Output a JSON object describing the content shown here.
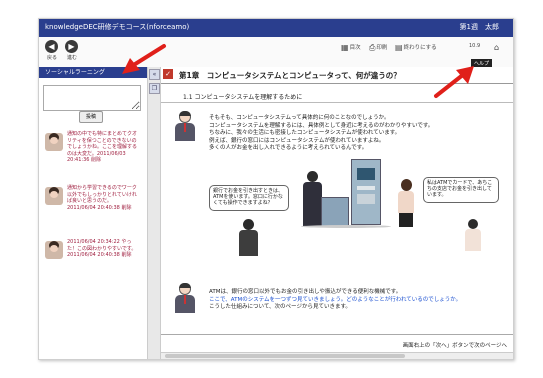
{
  "window": {
    "app_title": "knowledgeDEC研修デモコース(nforceamo)",
    "user_label": "第1週　太郎"
  },
  "toolbar": {
    "back_label": "戻る",
    "forward_label": "進む",
    "tools": [
      {
        "icon": "grid-icon",
        "glyph": "▦",
        "label": "目次"
      },
      {
        "icon": "print-icon",
        "glyph": "⎙",
        "label": "印刷"
      },
      {
        "icon": "book-icon",
        "glyph": "▤",
        "label": "終わりにする"
      }
    ],
    "small_text": "10.9",
    "tooltip": "ヘルプ"
  },
  "sidebar": {
    "header": "ソーシャルラーニング",
    "search_placeholder": "",
    "post_button": "投稿",
    "messages": [
      "通知の中でも特にまとめてクオリティを保つことのできないのでしょうかね。ここを理解するのは大変だ。2011/06/03 20:41:36 削除",
      "通知から学習できるのでワーク以外でもしっかりとれていければ良いと思うのだ。2011/06/04 20:40:38 削除",
      "2011/06/04 20:34:22 やった！この図わかりやすいです。 2011/06/04 20:40:38 削除"
    ]
  },
  "content": {
    "chapter_title": "第1章　コンピュータシステムとコンピュータって、何が違うの？",
    "section_title": "1.1 コンピュータシステムを理解するために",
    "paragraph1": [
      "そもそも、コンピュータシステムって具体的に何のことなのでしょうか。",
      "コンピュータシステムを理解するには、具体例として身近に考えるのがわかりやすいです。",
      "ちなみに、我々の生活にも密接したコンピュータシステムが使われています。",
      "例えば、銀行の窓口にはコンピュータシステムが使われていますよね。",
      "多くの人がお金を出し入れできるように考えられているんです。"
    ],
    "bubble_left": "銀行でお金を引き出すときは、ATMを使います。窓口に行かなくても操作できますよね？",
    "bubble_right": "私はATMでカードで、あちこちの支店でお金を引き出しています。",
    "paragraph2": [
      "ATMは、銀行の窓口以外でもお金の引き出しや振込ができる便利な機械です。",
      "ここで、ATMのシステムを一つずつ見ていきましょう。どのようなことが行われているのでしょうか。",
      "こうした仕組みについて、次のページから見ていきます。"
    ],
    "footer_note": "画面右上の「次へ」ボタンで次のページへ"
  },
  "colors": {
    "brand_blue": "#2a3e8e",
    "chapter_icon": "#c0392b",
    "message_text": "#a02040",
    "arrow": "#e0201a"
  }
}
